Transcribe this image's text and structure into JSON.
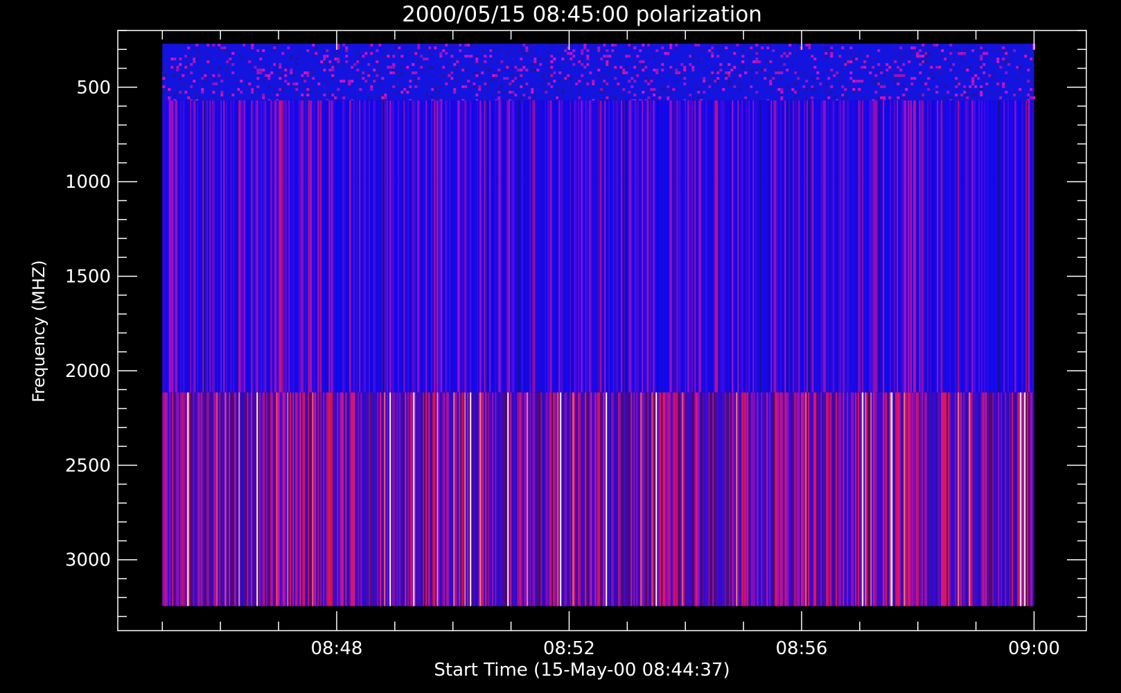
{
  "chart_data": {
    "type": "heatmap",
    "title": "2000/05/15 08:45:00 polarization",
    "xlabel": "Start Time (15-May-00 08:44:37)",
    "ylabel": "Frequency (MHZ)",
    "x_major_ticks": [
      "08:48",
      "08:52",
      "08:56",
      "09:00"
    ],
    "y_major_ticks": [
      500,
      1000,
      1500,
      2000,
      2500,
      3000
    ],
    "xlim": [
      "08:44:14",
      "09:00:54"
    ],
    "ylim": [
      3375,
      200
    ],
    "y_inverted": true,
    "data_time_range": [
      "08:45:00",
      "09:00:00"
    ],
    "frequency_bands_mhz": [
      {
        "from": 270,
        "to": 570,
        "appearance": "speckled blue and red noise"
      },
      {
        "from": 570,
        "to": 990,
        "appearance": "blue with vertical red streaks"
      },
      {
        "from": 990,
        "to": 2115,
        "appearance": "blue with vertical red streaks"
      },
      {
        "from": 2115,
        "to": 3245,
        "appearance": "blue-purple with frequent red and white vertical lines"
      }
    ],
    "colors": {
      "background": "#000000",
      "axes": "#ffffff",
      "low_polarization": "#1010e6",
      "high_polarization": "#e61010",
      "highlight": "#ffffff"
    },
    "grid": false
  }
}
